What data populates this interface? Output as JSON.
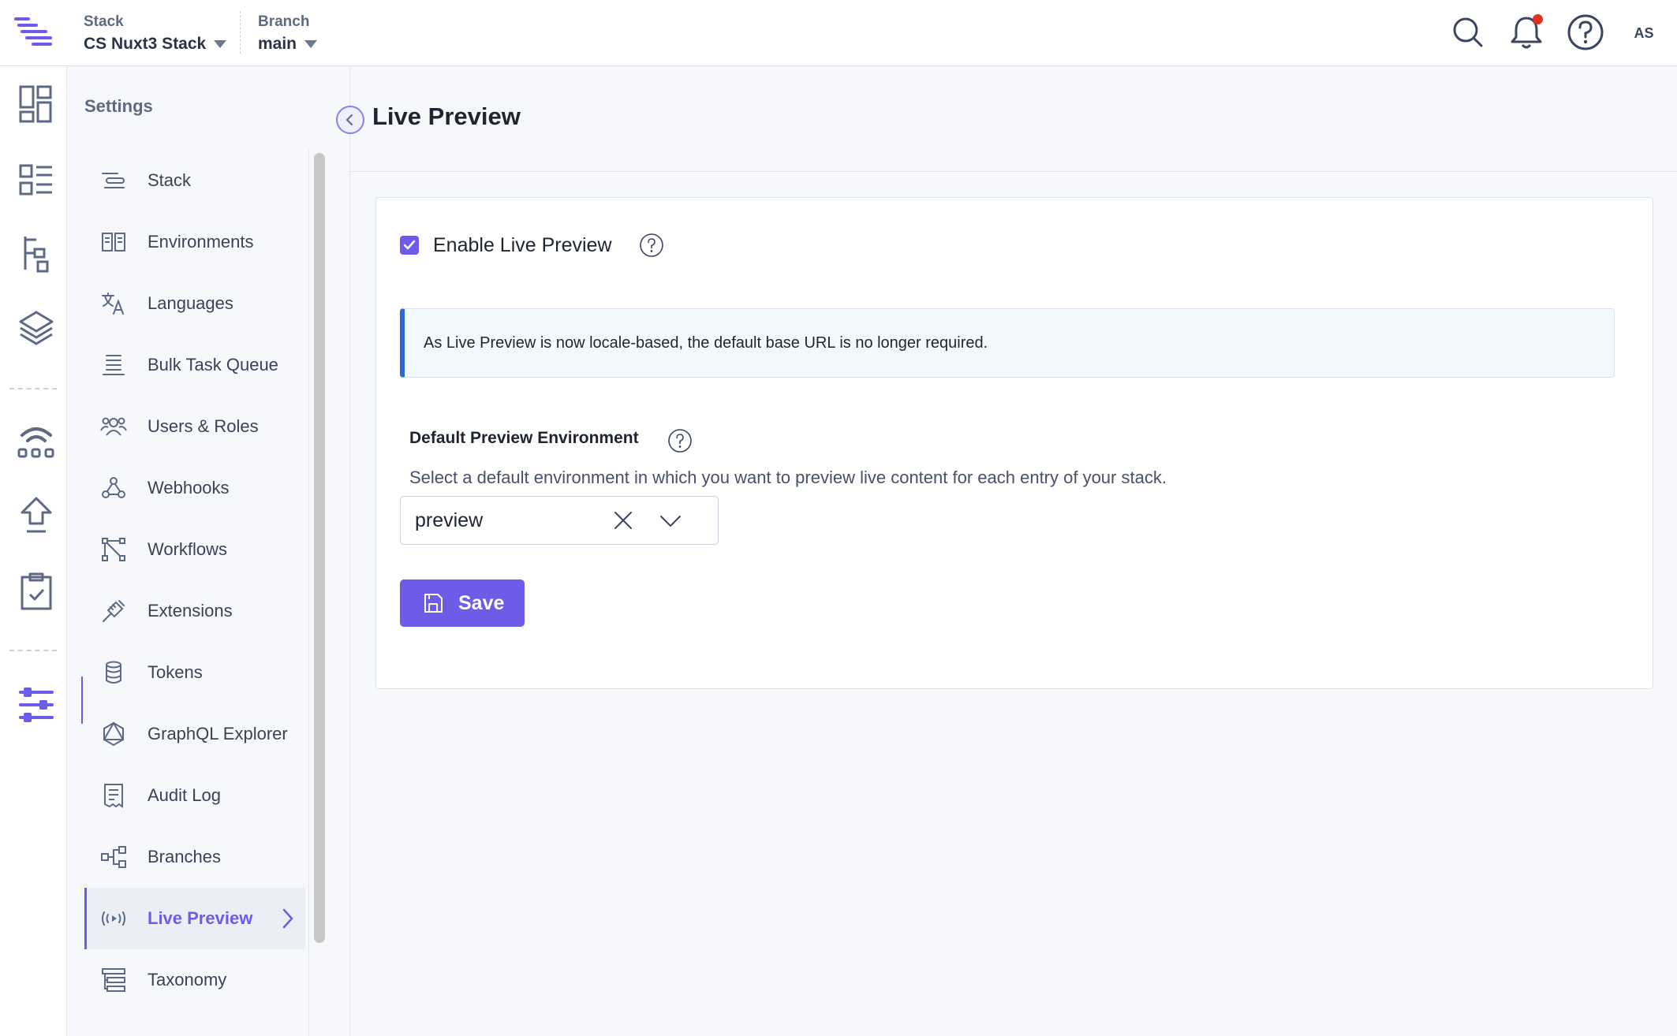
{
  "topbar": {
    "stack_label": "Stack",
    "stack_value": "CS Nuxt3 Stack",
    "branch_label": "Branch",
    "branch_value": "main",
    "avatar_initials": "AS",
    "notification_dot_color": "#e0301e"
  },
  "rail": {
    "icons": [
      "dashboard-icon",
      "content-models-icon",
      "entries-icon",
      "assets-icon",
      "releases-icon",
      "deploy-icon",
      "tasks-icon",
      "settings-icon"
    ]
  },
  "sidebar": {
    "title": "Settings",
    "items": [
      {
        "label": "Stack",
        "icon": "stack-icon"
      },
      {
        "label": "Environments",
        "icon": "environments-icon"
      },
      {
        "label": "Languages",
        "icon": "languages-icon"
      },
      {
        "label": "Bulk Task Queue",
        "icon": "bulk-task-queue-icon"
      },
      {
        "label": "Users & Roles",
        "icon": "users-roles-icon"
      },
      {
        "label": "Webhooks",
        "icon": "webhooks-icon"
      },
      {
        "label": "Workflows",
        "icon": "workflows-icon"
      },
      {
        "label": "Extensions",
        "icon": "extensions-icon"
      },
      {
        "label": "Tokens",
        "icon": "tokens-icon"
      },
      {
        "label": "GraphQL Explorer",
        "icon": "graphql-icon"
      },
      {
        "label": "Audit Log",
        "icon": "audit-log-icon"
      },
      {
        "label": "Branches",
        "icon": "branches-icon"
      },
      {
        "label": "Live Preview",
        "icon": "live-preview-icon",
        "active": true
      },
      {
        "label": "Taxonomy",
        "icon": "taxonomy-icon"
      }
    ]
  },
  "main": {
    "title": "Live Preview",
    "enable_label": "Enable Live Preview",
    "enable_checked": true,
    "info_text": "As Live Preview is now locale-based, the default base URL is no longer required.",
    "env_label": "Default Preview Environment",
    "env_description": "Select a default environment in which you want to preview live content for each entry of your stack.",
    "env_value": "preview",
    "save_label": "Save"
  },
  "colors": {
    "accent": "#6c5ce7",
    "info_border": "#2f66d8"
  }
}
